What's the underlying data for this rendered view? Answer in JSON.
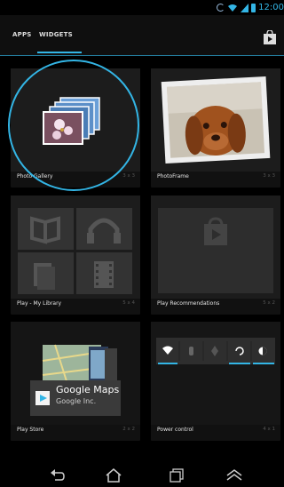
{
  "status_bar": {
    "time": "12:00",
    "icons": [
      "sync-icon",
      "wifi-icon",
      "signal-icon",
      "battery-icon"
    ]
  },
  "tabs": [
    {
      "label": "APPS",
      "selected": false
    },
    {
      "label": "WIDGETS",
      "selected": true
    }
  ],
  "store_icon": "play-store-bag-icon",
  "widgets": [
    {
      "name": "Photo Gallery",
      "size": "3 x 3",
      "highlighted": true
    },
    {
      "name": "PhotoFrame",
      "size": "3 x 3"
    },
    {
      "name": "Play - My Library",
      "size": "5 x 4"
    },
    {
      "name": "Play Recommendations",
      "size": "5 x 2"
    },
    {
      "name": "Play Store",
      "size": "2 x 2",
      "preview": {
        "title": "Google Maps",
        "subtitle": "Google Inc."
      }
    },
    {
      "name": "Power control",
      "size": "4 x 1"
    }
  ],
  "nav": [
    "back-icon",
    "home-icon",
    "recent-apps-icon",
    "menu-icon"
  ],
  "colors": {
    "accent": "#33b5e5",
    "background": "#000000",
    "card": "#1c1c1c"
  }
}
